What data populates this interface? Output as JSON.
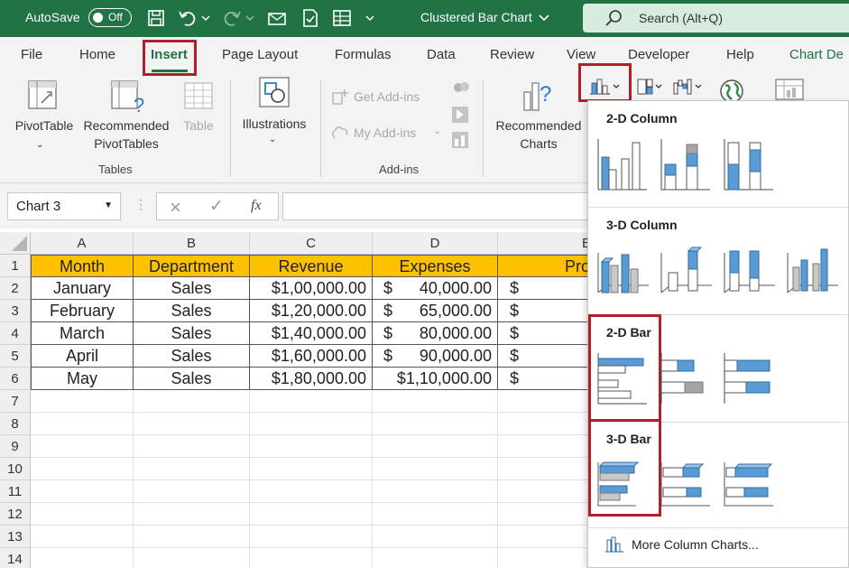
{
  "titlebar": {
    "autosave_label": "AutoSave",
    "autosave_state": "Off",
    "document_title": "Clustered Bar Chart",
    "search_placeholder": "Search (Alt+Q)"
  },
  "ribbon": {
    "tabs": [
      "File",
      "Home",
      "Insert",
      "Page Layout",
      "Formulas",
      "Data",
      "Review",
      "View",
      "Developer",
      "Help",
      "Chart De"
    ],
    "active_tab": "Insert",
    "tables_group": {
      "label": "Tables",
      "pivottable": "PivotTable",
      "recommended_pivottables_l1": "Recommended",
      "recommended_pivottables_l2": "PivotTables",
      "table": "Table"
    },
    "illustrations": "Illustrations",
    "addins_group": {
      "label": "Add-ins",
      "get_addins": "Get Add-ins",
      "my_addins": "My Add-ins"
    },
    "recommended_charts_l1": "Recommended",
    "recommended_charts_l2": "Charts"
  },
  "formula_bar": {
    "name_box": "Chart 3",
    "cancel": "×",
    "enter": "✓",
    "fx": "fx"
  },
  "sheet": {
    "columns": [
      "A",
      "B",
      "C",
      "D",
      "E"
    ],
    "rows": [
      "1",
      "2",
      "3",
      "4",
      "5",
      "6",
      "7",
      "8",
      "9",
      "10",
      "11",
      "12",
      "13",
      "14"
    ],
    "headers": [
      "Month",
      "Department",
      "Revenue",
      "Expenses",
      "Pro"
    ],
    "data": [
      {
        "month": "January",
        "dept": "Sales",
        "revenue": "$1,00,000.00",
        "exp_sym": "$",
        "exp_val": "40,000.00",
        "profit_sym": "$"
      },
      {
        "month": "February",
        "dept": "Sales",
        "revenue": "$1,20,000.00",
        "exp_sym": "$",
        "exp_val": "65,000.00",
        "profit_sym": "$"
      },
      {
        "month": "March",
        "dept": "Sales",
        "revenue": "$1,40,000.00",
        "exp_sym": "$",
        "exp_val": "80,000.00",
        "profit_sym": "$"
      },
      {
        "month": "April",
        "dept": "Sales",
        "revenue": "$1,60,000.00",
        "exp_sym": "$",
        "exp_val": "90,000.00",
        "profit_sym": "$"
      },
      {
        "month": "May",
        "dept": "Sales",
        "revenue": "$1,80,000.00",
        "exp_sym": "",
        "exp_val": "$1,10,000.00",
        "profit_sym": "$"
      }
    ]
  },
  "dropdown": {
    "sections": [
      "2-D Column",
      "3-D Column",
      "2-D Bar",
      "3-D Bar"
    ],
    "more": "More Column Charts..."
  },
  "colors": {
    "excel_green": "#217346",
    "header_fill": "#ffc000",
    "highlight_red": "#b0202a",
    "chart_blue": "#5b9bd5",
    "chart_gray": "#a5a5a5"
  }
}
